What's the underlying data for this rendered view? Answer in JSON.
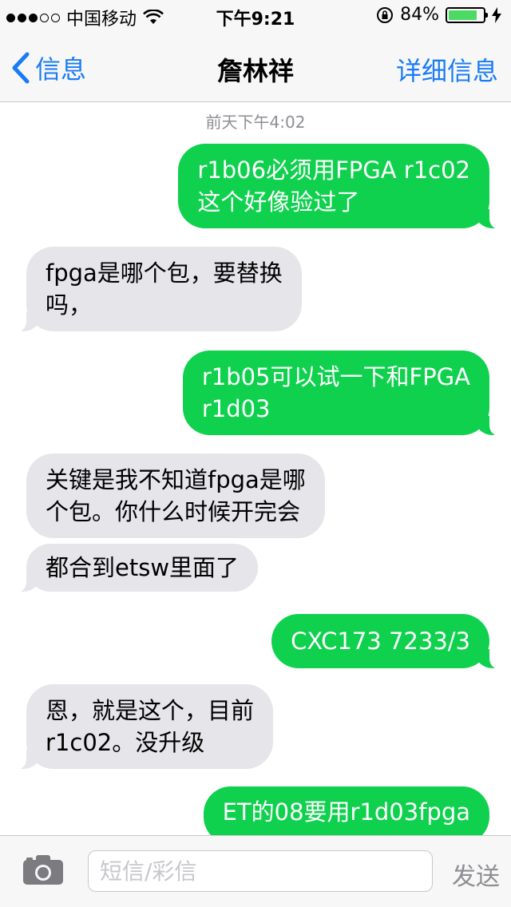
{
  "status_bar": {
    "carrier": "中国移动",
    "time": "下午9:21",
    "battery": "84%",
    "battery_level": 0.84,
    "signal_bars_filled": 3,
    "signal_bars_total": 5
  },
  "nav": {
    "back_label": "信息",
    "title": "詹林祥",
    "details_label": "详细信息"
  },
  "conversation": {
    "timestamp": "前天下午4:02",
    "messages": [
      {
        "from": "me",
        "text": "r1b06必须用FPGA r1c02\n这个好像验过了"
      },
      {
        "from": "them",
        "text": "fpga是哪个包，要替换\n吗，"
      },
      {
        "from": "me",
        "text": "r1b05可以试一下和FPGA\nr1d03"
      },
      {
        "from": "them",
        "text": "关键是我不知道fpga是哪\n个包。你什么时候开完会"
      },
      {
        "from": "them",
        "text": "都合到etsw里面了"
      },
      {
        "from": "me",
        "text": "CXC173 7233/3"
      },
      {
        "from": "them",
        "text": "恩，就是这个，目前\nr1c02。没升级"
      },
      {
        "from": "me",
        "text": "ET的08要用r1d03fpga"
      }
    ]
  },
  "composer": {
    "placeholder": "短信/彩信",
    "send_label": "发送"
  },
  "colors": {
    "accent": "#1a7cf5",
    "sent_bubble": "#0fd14e",
    "received_bubble": "#e5e5ea"
  }
}
